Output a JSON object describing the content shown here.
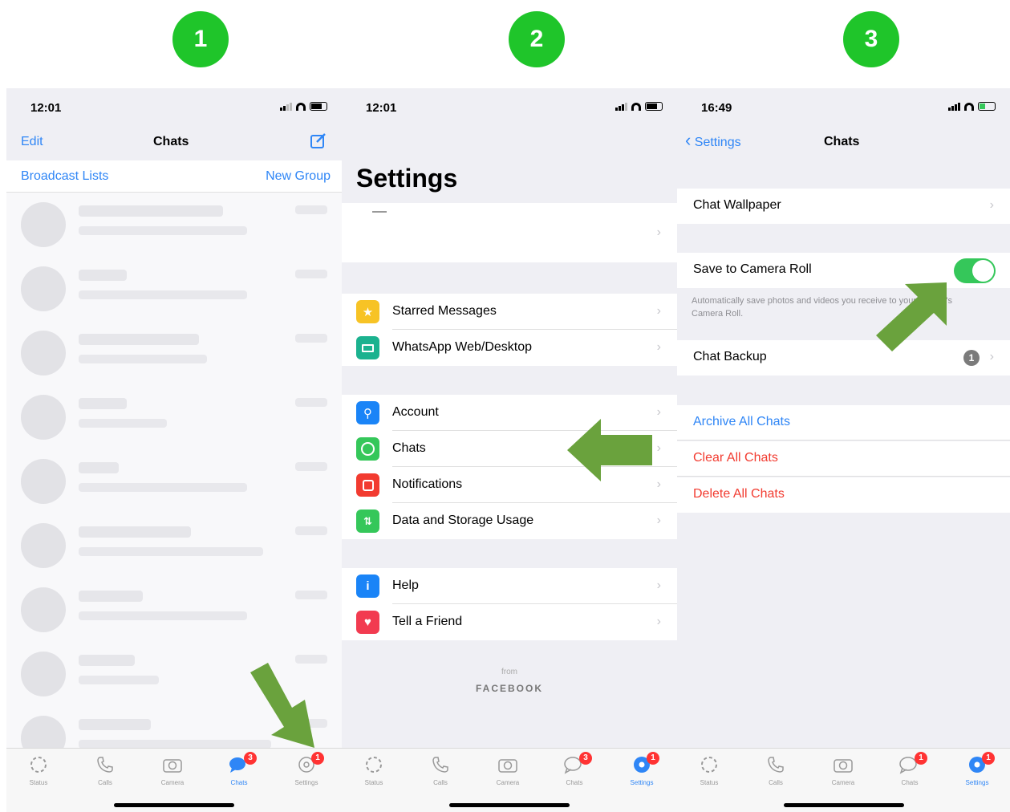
{
  "steps": [
    "1",
    "2",
    "3"
  ],
  "p1": {
    "time": "12:01",
    "edit": "Edit",
    "title": "Chats",
    "broadcast": "Broadcast Lists",
    "new_group": "New Group"
  },
  "p2": {
    "time": "12:01",
    "title": "Settings",
    "items": [
      {
        "label": "Starred Messages",
        "icon": "star-icon",
        "color": "#f7c325"
      },
      {
        "label": "WhatsApp Web/Desktop",
        "icon": "laptop-icon",
        "color": "#1bb28f"
      },
      {
        "label": "Account",
        "icon": "key-icon",
        "color": "#1a84f7"
      },
      {
        "label": "Chats",
        "icon": "whatsapp-icon",
        "color": "#35c75a"
      },
      {
        "label": "Notifications",
        "icon": "notification-icon",
        "color": "#f23b30"
      },
      {
        "label": "Data and Storage Usage",
        "icon": "data-arrows-icon",
        "color": "#35c75a"
      },
      {
        "label": "Help",
        "icon": "info-icon",
        "color": "#1a84f7"
      },
      {
        "label": "Tell a Friend",
        "icon": "heart-icon",
        "color": "#f23b50"
      }
    ],
    "from": "from",
    "facebook": "FACEBOOK"
  },
  "p3": {
    "time": "16:49",
    "back": "Settings",
    "title": "Chats",
    "wallpaper": "Chat Wallpaper",
    "save_roll": "Save to Camera Roll",
    "save_roll_on": true,
    "note": "Automatically save photos and videos you receive to your iPhone's Camera Roll.",
    "backup": "Chat Backup",
    "backup_badge": "1",
    "archive": "Archive All Chats",
    "clear": "Clear All Chats",
    "delete": "Delete All Chats"
  },
  "tabs": [
    "Status",
    "Calls",
    "Camera",
    "Chats",
    "Settings"
  ],
  "badges": {
    "p1_chats": "3",
    "p1_settings": "1",
    "p2_chats": "3",
    "p2_settings": "1",
    "p3_chats": "1",
    "p3_settings": "1"
  },
  "colors": {
    "step": "#1fc52a",
    "ios_blue": "#2f86f6",
    "danger": "#f23b30",
    "toggle": "#35c75a",
    "arrow": "#6aa23d"
  }
}
